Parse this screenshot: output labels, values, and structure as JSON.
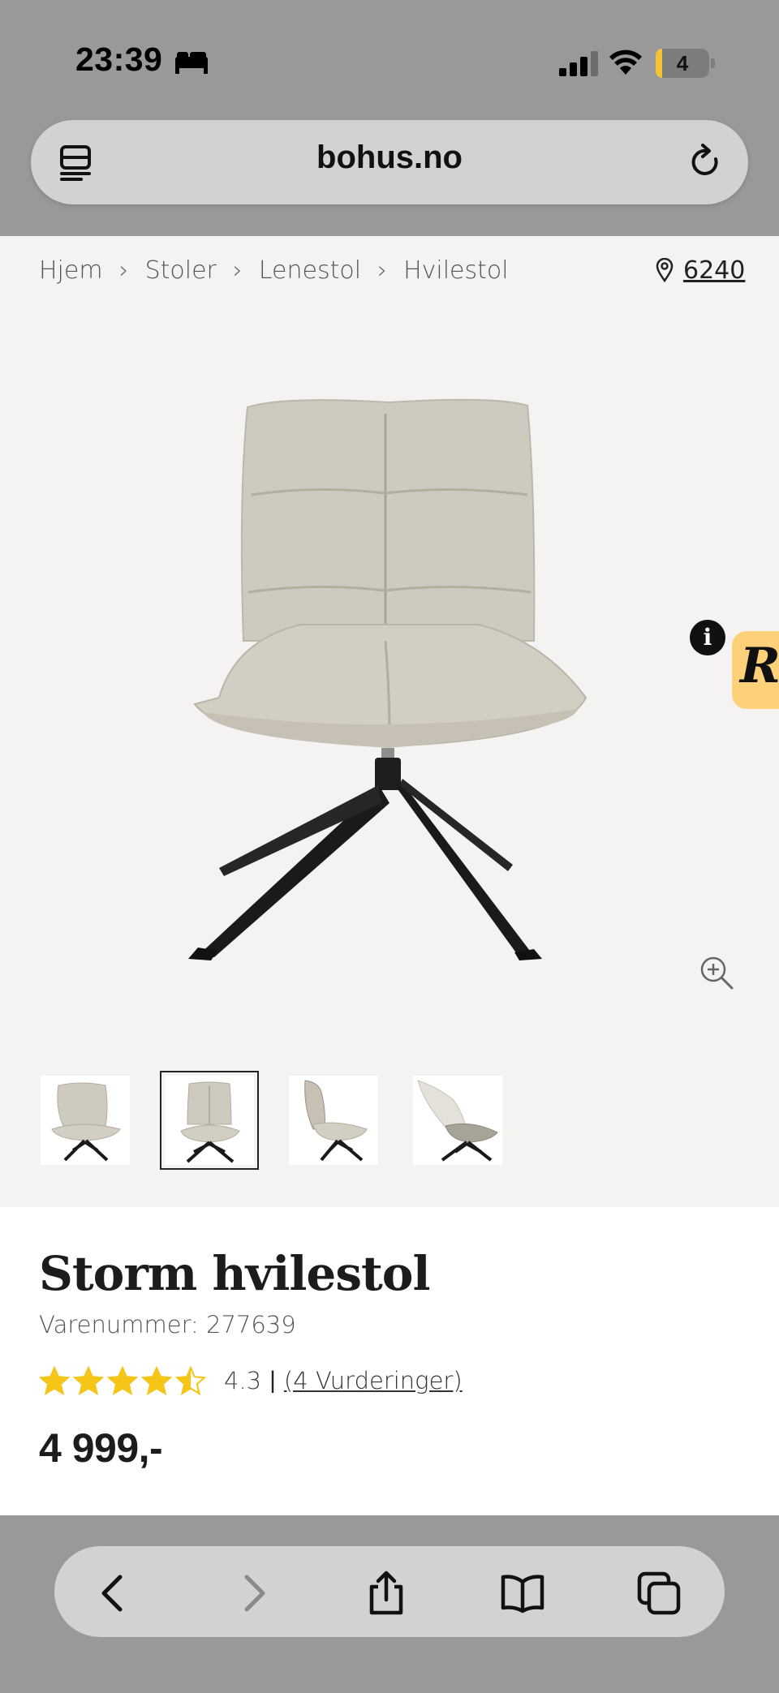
{
  "status_bar": {
    "time": "23:39",
    "battery": "4",
    "focus_icon": "bed-icon"
  },
  "address_bar": {
    "url": "bohus.no",
    "left_icon": "tabs-overview-icon",
    "right_icon": "reload-icon"
  },
  "breadcrumb": {
    "items": [
      "Hjem",
      "Stoler",
      "Lenestol",
      "Hvilestol"
    ],
    "location": "6240"
  },
  "gallery": {
    "thumbnails_count": 4,
    "selected_index": 1,
    "badge_letter": "R",
    "info_label": "i"
  },
  "product": {
    "title": "Storm hvilestol",
    "sku": "Varenummer: 277639",
    "rating_value": "4.3",
    "rating_stars": 4.5,
    "rating_separator": "|",
    "reviews_link": "(4 Vurderinger)",
    "price": "4 999,-"
  },
  "colors": {
    "star": "#f5c518",
    "chrome": "#999999",
    "gallery_bg": "#f5f3f2",
    "badge": "#fdd179"
  },
  "toolbar": {
    "icons": [
      "back-icon",
      "forward-icon",
      "share-icon",
      "bookmarks-icon",
      "tabs-icon"
    ]
  }
}
